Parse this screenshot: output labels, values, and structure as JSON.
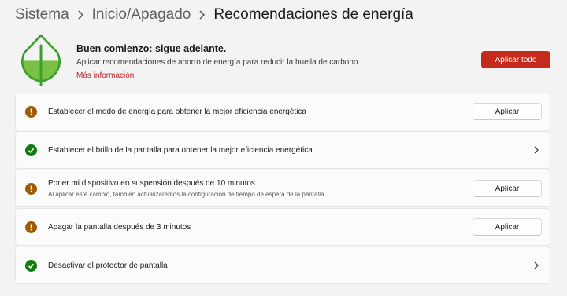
{
  "breadcrumb": {
    "items": [
      "Sistema",
      "Inicio/Apagado"
    ],
    "current": "Recomendaciones de energía"
  },
  "banner": {
    "title": "Buen comienzo: sigue adelante.",
    "subtitle": "Aplicar recomendaciones de ahorro de energía para reducir la huella de carbono",
    "link": "Más información",
    "apply_all": "Aplicar todo",
    "leaf_fill_level": 0.45
  },
  "recommendations": [
    {
      "title": "Establecer el modo de energía para obtener la mejor eficiencia energética",
      "status": "pending",
      "action": "Aplicar"
    },
    {
      "title": "Establecer el brillo de la pantalla para obtener la mejor eficiencia energética",
      "status": "applied"
    },
    {
      "title": "Poner mi dispositivo en suspensión después de 10 minutos",
      "subtitle": "Al aplicar este cambio, también actualizaremos la configuración de tiempo de espera de la pantalla.",
      "status": "pending",
      "action": "Aplicar"
    },
    {
      "title": "Apagar la pantalla después de 3 minutos",
      "status": "pending",
      "action": "Aplicar"
    },
    {
      "title": "Desactivar el protector de pantalla",
      "status": "applied"
    }
  ],
  "colors": {
    "accent": "#c42b1c",
    "warning": "#9d5d00",
    "success": "#107c10",
    "leaf_green": "#7ac143",
    "leaf_dark": "#3a9f2e"
  },
  "icons": {
    "separator": "chevron-right-icon",
    "leaf": "leaf-icon",
    "pending": "exclamation-icon",
    "applied": "checkmark-icon",
    "expand": "chevron-right-icon"
  }
}
